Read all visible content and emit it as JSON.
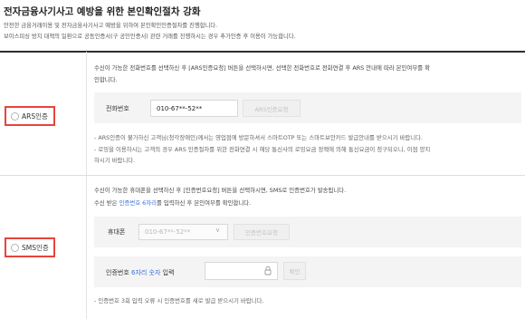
{
  "page": {
    "title": "전자금융사기사고 예방을 위한 본인확인절차 강화",
    "intro_line1": "안전한 금융거래이용 및 전자금융사기사고 예방을 위하여 본인확인인증절차를 진행합니다.",
    "intro_line2": "보이스피싱 방지 대책의 일환으로 공동인증서(구 공인인증서) 관련 거래를 진행하시는 경우 추가인증 후 이용이 가능합니다."
  },
  "ars": {
    "radio_label": "ARS인증",
    "desc_line1": "수신이 가능한 전화번호를 선택하신 후 [ARS인증요청] 버튼을 선택하시면, 선택한 전화번호로 전화연결 후 ARS 안내에 따라 본인여부를 확",
    "desc_line2": "인합니다.",
    "phone_label": "전화번호",
    "phone_value": "010-67**-52**",
    "request_button": "ARS인증요청",
    "note1": "- ARS인증이 불가하신 고객님(청각장애인)께서는 영업점에 방문하셔서 스마트OTP 또는 스마트보안카드 발급안내를 받으시기 바랍니다.",
    "note2_line1": "- 로밍을 이용하시는 고객의 경우 ARS 인증절차를 위한 전화연결 시 해당 통신사의 로밍요금 정책에 의해 통신요금이 청구되오니, 이점 양지",
    "note2_line2": "하시기 바랍니다."
  },
  "sms": {
    "radio_label": "SMS인증",
    "desc_line1": "수신이 가능한 휴대폰을 선택하신 후 [인증번호요청] 버튼을 선택하시면, SMS로 인증번호가 발송됩니다.",
    "desc2_before": "수신 받은 ",
    "desc2_highlight": "인증번호 6자리",
    "desc2_after": "를 입력하신 후 본인여부를 확인합니다.",
    "phone_label": "휴대폰",
    "phone_value": "010-67**-52**",
    "request_button": "인증번호요청",
    "code_label_before": "인증번호 ",
    "code_label_highlight": "6자리 숫자",
    "code_label_after": " 입력",
    "confirm_button": "확인",
    "note": "- 인증번호 3회 입력 오류 시 인증번호를 새로 발급 받으시기 바랍니다."
  },
  "icons": {
    "dropdown": "chevron-down-icon",
    "lock": "lock-icon",
    "radio": "radio-icon"
  },
  "colors": {
    "highlight": "#3a6fd8",
    "annotation_border": "#e8443b",
    "top_rule": "#2d2d2d"
  }
}
